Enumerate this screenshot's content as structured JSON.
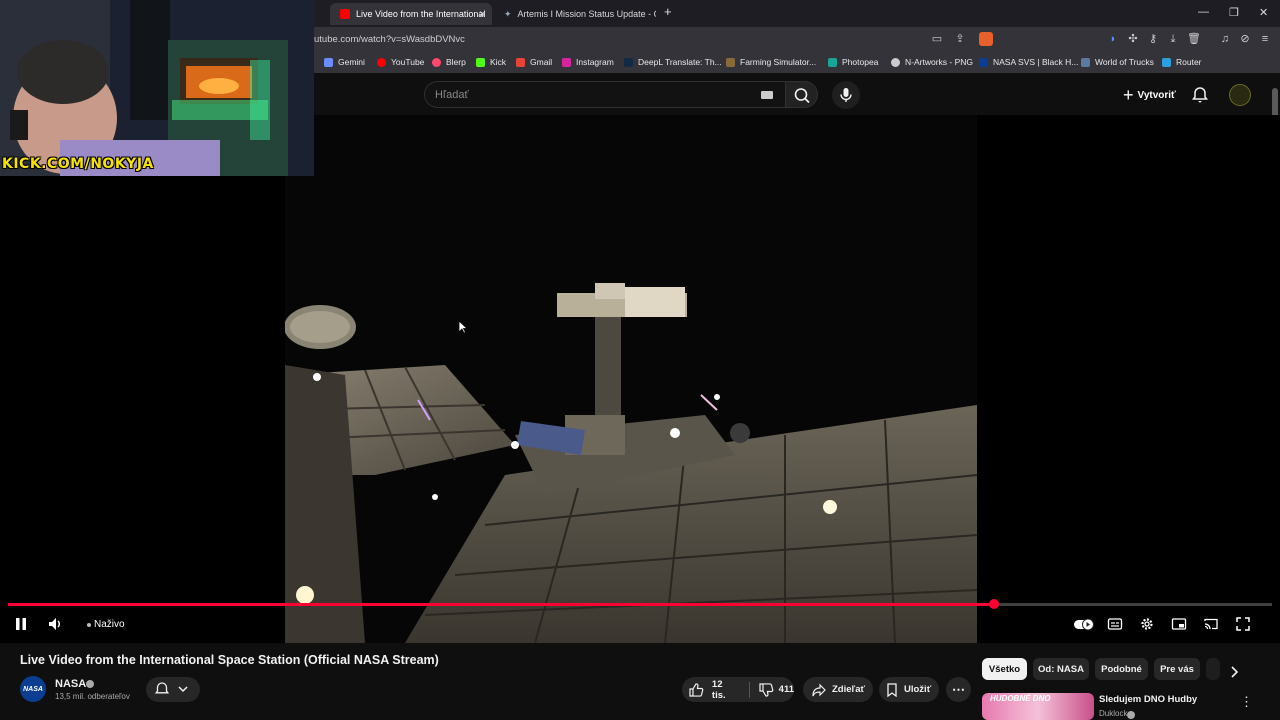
{
  "browser": {
    "tabs": [
      {
        "title": "Live Video from the International",
        "active": true
      },
      {
        "title": "Artemis I Mission Status Update - Go",
        "active": false
      }
    ],
    "new_tab": "+",
    "url": "utube.com/watch?v=sWasdbDVNvc",
    "bookmarks": [
      {
        "label": "Gemini",
        "color": "#6b8cff"
      },
      {
        "label": "YouTube",
        "color": "#ff0000"
      },
      {
        "label": "Blerp",
        "color": "#ff4a6e"
      },
      {
        "label": "Kick",
        "color": "#53fc18"
      },
      {
        "label": "Gmail",
        "color": "#ea4335"
      },
      {
        "label": "Instagram",
        "color": "#d6249f"
      },
      {
        "label": "DeepL Translate: Th...",
        "color": "#0f2b46"
      },
      {
        "label": "Farming Simulator...",
        "color": "#8b6a3a"
      },
      {
        "label": "Photopea",
        "color": "#18a497"
      },
      {
        "label": "N-Artworks - PNG",
        "color": "#cccccc"
      },
      {
        "label": "NASA SVS | Black H...",
        "color": "#0b3d91"
      },
      {
        "label": "World of Trucks",
        "color": "#5a7aa0"
      },
      {
        "label": "Router",
        "color": "#2aa0e0"
      }
    ]
  },
  "youtube": {
    "search_placeholder": "Hľadať",
    "create_label": "Vytvoriť"
  },
  "webcam": {
    "watermark": "KICK.COM/NOKYJA"
  },
  "player": {
    "live_label": "Naživo",
    "progress_fraction": 0.78
  },
  "video": {
    "title": "Live Video from the International Space Station (Official NASA Stream)",
    "channel": "NASA",
    "channel_avatar_text": "NASA",
    "subscribers": "13,5 mil. odberateľov",
    "likes": "12 tis.",
    "dislikes": "411",
    "share_label": "Zdieľať",
    "save_label": "Uložiť"
  },
  "chips": [
    "Všetko",
    "Od: NASA",
    "Podobné",
    "Pre vás"
  ],
  "recommendation": {
    "title": "Sledujem DNO Hudby",
    "channel": "Duklock",
    "thumb_text": "HUDOBNÉ DNO"
  }
}
